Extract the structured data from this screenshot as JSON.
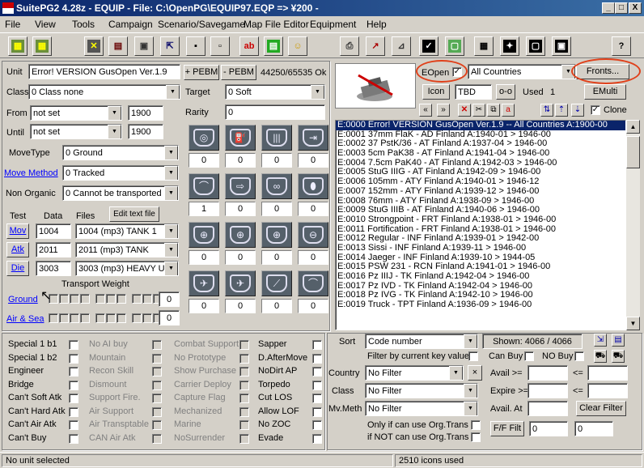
{
  "window": {
    "title": "SuitePG2 4.28z - EQUIP - File: C:\\OpenPG\\EQUIP97.EQP => ¥200 -",
    "min": "_",
    "max": "□",
    "close": "X"
  },
  "menu": [
    "File",
    "View",
    "Tools",
    "Campaign",
    "Scenario/Savegame",
    "Map File Editor",
    "Equipment",
    "Help"
  ],
  "toolbar_icons": [
    "map-icon",
    "grid-icon",
    "unit-xxx-icon",
    "pdf-icon",
    "gui-icon",
    "export-icon",
    "save-icon",
    "disk-icon",
    "abc-spell-icon",
    "abc-green-icon",
    "face-icon",
    "printer-icon",
    "graph-icon",
    "compare-icon",
    "check-icon",
    "preview-icon",
    "calculator-icon",
    "sparkle-icon",
    "window-icon",
    "photo-icon",
    "help-icon"
  ],
  "unit": {
    "label": "Unit",
    "value": "Error! VERSION GusOpen Ver.1.9",
    "pebm_plus": "+ PEBM",
    "pebm_minus": "- PEBM",
    "counter": "44250/65535 Ok"
  },
  "class": {
    "label": "Class",
    "value": "0  Class none"
  },
  "from": {
    "label": "From",
    "value": "not set",
    "year": "1900"
  },
  "until": {
    "label": "Until",
    "value": "not set",
    "year": "1900"
  },
  "movetype": {
    "label": "MoveType",
    "value": "0  Ground"
  },
  "movemethod": {
    "label": "Move Method",
    "value": "0  Tracked"
  },
  "nonorganic": {
    "label": "Non Organic",
    "value": "0  Cannot be transported"
  },
  "target": {
    "label": "Target",
    "value": "0  Soft"
  },
  "rarity": {
    "label": "Rarity",
    "value": "0"
  },
  "files": {
    "test": "Test",
    "data": "Data",
    "files": "Files",
    "edit": "Edit text file",
    "rows": [
      {
        "btn": "Mov",
        "data": "1004",
        "file": "1004  (mp3) TANK 1"
      },
      {
        "btn": "Atk",
        "data": "2011",
        "file": "2011  (mp3) TANK"
      },
      {
        "btn": "Die",
        "data": "3003",
        "file": "3003  (mp3) HEAVY U"
      }
    ]
  },
  "transport": {
    "label": "Transport Weight",
    "ground": "Ground",
    "airsea": "Air & Sea",
    "ground_val": "0",
    "airsea_val": "0"
  },
  "stats": {
    "icons": [
      "initiative-icon",
      "fuel-icon",
      "ammo-icon",
      "spotting-icon",
      "movement-arc-icon",
      "move-icon",
      "binoculars-icon",
      "bomb-icon",
      "soft-attack-icon",
      "hard-attack-icon",
      "air-attack-icon",
      "naval-attack-icon",
      "ground-defense-icon",
      "air-defense-icon",
      "close-defense-icon",
      "range-icon"
    ],
    "values": [
      "0",
      "0",
      "0",
      "0",
      "1",
      "0",
      "0",
      "0",
      "0",
      "0",
      "0",
      "0",
      "0",
      "0",
      "0",
      "0"
    ]
  },
  "eopen": {
    "label": "EOpen",
    "checked": "✓",
    "country": "All Countries",
    "fronts": "Fronts...",
    "icon_btn": "Icon",
    "tbd": "TBD",
    "oo": "o-o",
    "used_label": "Used",
    "used_val": "1",
    "emulti": "EMulti",
    "clone": "Clone"
  },
  "listnav": [
    "«",
    "»",
    "✕"
  ],
  "units": [
    "E:0000  Error! VERSION GusOpen Ver.1.9  --  All Countries  A:1900-00",
    "E:0001  37mm FlaK - AD  Finland  A:1940-01 > 1946-00",
    "E:0002  37 PstK/36 - AT  Finland  A:1937-04 > 1946-00",
    "E:0003  5cm PaK38 - AT  Finland  A:1941-04 > 1946-00",
    "E:0004  7.5cm PaK40 - AT  Finland  A:1942-03 > 1946-00",
    "E:0005  StuG IIIG - AT  Finland  A:1942-09 > 1946-00",
    "E:0006  105mm - ATY  Finland  A:1940-01 > 1946-12",
    "E:0007  152mm - ATY  Finland  A:1939-12 > 1946-00",
    "E:0008  76mm - ATY  Finland  A:1938-09 > 1946-00",
    "E:0009  StuG IIIB - AT  Finland  A:1940-06 > 1946-00",
    "E:0010  Strongpoint - FRT  Finland  A:1938-01 > 1946-00",
    "E:0011  Fortification - FRT  Finland  A:1938-01 > 1946-00",
    "E:0012  Regular - INF  Finland  A:1939-01 > 1942-00",
    "E:0013  Sissi - INF  Finland  A:1939-11 > 1946-00",
    "E:0014  Jaeger - INF  Finland  A:1939-10 > 1944-05",
    "E:0015  PSW 231 - RCN  Finland  A:1941-01 > 1946-00",
    "E:0016  Pz IIIJ -  TK  Finland  A:1942-04 > 1946-00",
    "E:0017  Pz IVD -  TK  Finland  A:1942-04 > 1946-00",
    "E:0018  Pz IVG -  TK  Finland  A:1942-10 > 1946-00",
    "E:0019  Truck - TPT  Finland  A:1936-09 > 1946-00"
  ],
  "flags_col1": [
    "Special 1 b1",
    "Special 1 b2",
    "Engineer",
    "Bridge",
    "Can't Soft Atk",
    "Can't Hard Atk",
    "Can't Air  Atk",
    "Can't Buy"
  ],
  "flags_col2": [
    "No AI buy",
    "Mountain",
    "Recon Skill",
    "Dismount",
    "Support Fire.",
    "Air Support",
    "Air Transptable",
    "CAN Air  Atk"
  ],
  "flags_col3": [
    "Combat Support",
    "No Prototype",
    "Show Purchase",
    "Carrier Deploy",
    "Capture Flag",
    "Mechanized",
    "Marine",
    "NoSurrender"
  ],
  "flags_col4": [
    "Sapper",
    "D.AfterMove",
    "NoDirt AP",
    "Torpedo",
    "Cut LOS",
    "Allow LOF",
    "No ZOC",
    "Evade"
  ],
  "filter": {
    "sort_label": "Sort",
    "sort_value": "Code number",
    "shown": "Shown: 4066 / 4066",
    "by_key": "Filter by current key value",
    "canbuy": "Can Buy",
    "nobuy": "NO Buy",
    "country_label": "Country",
    "country_value": "No Filter",
    "x": "×",
    "class_label": "Class",
    "class_value": "No Filter",
    "mvmeth_label": "Mv.Meth",
    "mvmeth_value": "No Filter",
    "avail": "Avail >=",
    "le": "<=",
    "expire": "Expire >=",
    "availat": "Avail. At",
    "clear": "Clear Filter",
    "only_if": "Only if can use Org.Trans",
    "if_not": "if NOT can use Org.Trans",
    "ff": "F/F Filt",
    "ff_a": "0",
    "ff_b": "0"
  },
  "status": {
    "left": "No unit selected",
    "right": "2510 icons used"
  }
}
